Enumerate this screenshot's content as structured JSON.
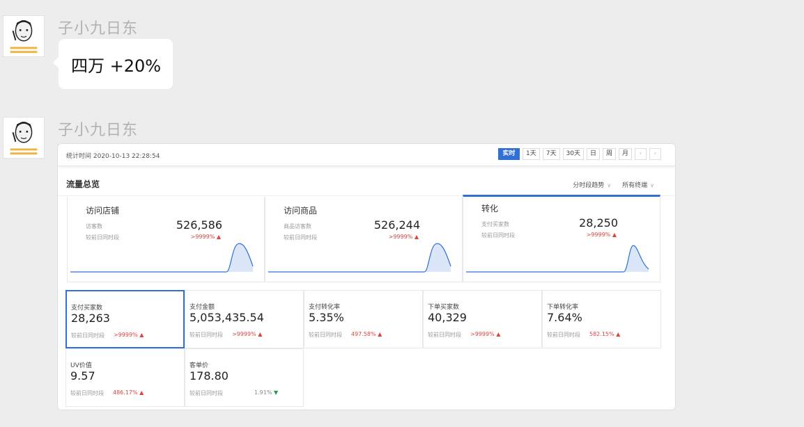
{
  "messages": [
    {
      "sender": "子小九日东",
      "text": "四万 +20%"
    },
    {
      "sender": "子小九日东"
    }
  ],
  "dashboard": {
    "stat_time": "统计时间 2020-10-13 22:28:54",
    "range_buttons": [
      "实时",
      "1天",
      "7天",
      "30天",
      "日",
      "周",
      "月"
    ],
    "prev_icon": "‹",
    "next_icon": "›",
    "title": "流量总览",
    "dropdowns": [
      "分时段趋势",
      "所有终端"
    ],
    "flows": [
      {
        "name": "访问店铺",
        "label1": "访客数",
        "value": "526,586",
        "label2": "较前日同时段",
        "change": ">9999%"
      },
      {
        "name": "访问商品",
        "label1": "商品访客数",
        "value": "526,244",
        "label2": "较前日同时段",
        "change": ">9999%"
      },
      {
        "name": "转化",
        "label1": "支付买家数",
        "value": "28,250",
        "label2": "较前日同时段",
        "change": ">9999%"
      }
    ],
    "metrics": [
      {
        "name": "支付买家数",
        "value": "28,263",
        "compare": "较前日同时段",
        "change": ">9999%",
        "dir": "up"
      },
      {
        "name": "支付金额",
        "value": "5,053,435.54",
        "compare": "较前日同时段",
        "change": ">9999%",
        "dir": "up"
      },
      {
        "name": "支付转化率",
        "value": "5.35%",
        "compare": "较前日同时段",
        "change": "497.58%",
        "dir": "up"
      },
      {
        "name": "下单买家数",
        "value": "40,329",
        "compare": "较前日同时段",
        "change": ">9999%",
        "dir": "up"
      },
      {
        "name": "下单转化率",
        "value": "7.64%",
        "compare": "较前日同时段",
        "change": "582.15%",
        "dir": "up"
      },
      {
        "name": "UV价值",
        "value": "9.57",
        "compare": "较前日同时段",
        "change": "486.17%",
        "dir": "up"
      },
      {
        "name": "客单价",
        "value": "178.80",
        "compare": "较前日同时段",
        "change": "1.91%",
        "dir": "down"
      }
    ],
    "colors": {
      "accent": "#2f6fd6",
      "up": "#e0443e",
      "down": "#1a9c4a"
    }
  }
}
